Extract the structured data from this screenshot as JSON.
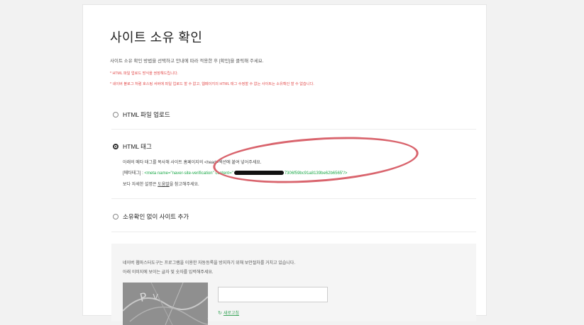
{
  "page": {
    "title": "사이트 소유 확인",
    "description": "사이트 소유 확인 방법을 선택하고 안내에 따라 적용한 후 [확인]을 클릭해 주세요.",
    "warnings": [
      "* HTML 파일 업로드 방식을 권장해드립니다.",
      "* 네이버 블로그 처럼 호스팅 서버에 파일 업로드 할 수 없고, 웹페이지의 HTML 태그 수정할 수 없는 사이트는 소유확인 할 수 없습니다."
    ]
  },
  "options": {
    "html_file": {
      "label": "HTML 파일 업로드",
      "selected": false
    },
    "html_tag": {
      "label": "HTML 태그",
      "selected": true,
      "line1": "아래의 메타 태그를 복사해 사이트 홈페이지의 <head>섹션에 붙여 넣어주세요.",
      "meta_prefix": "[메타태그] : ",
      "meta_code_start": "<meta name=\"naver-site-verification\" content=\"",
      "meta_code_end": "7306f59bc91a8139be62b6565\"/>",
      "help_prefix": "보다 자세한 설명은 ",
      "help_link": "도움말",
      "help_suffix": "을 참고해주세요."
    },
    "no_verify": {
      "label": "소유확인 없이 사이트 추가",
      "selected": false
    }
  },
  "captcha": {
    "line1": "네이버 웹마스터도구는 프로그램을 이용한 자동등록을 방지하기 위해 보안절차를 거치고 있습니다.",
    "line2": "아래 이미지에 보이는 글자 및 숫자를 입력해주세요.",
    "input_value": "",
    "refresh_label": "새로고침",
    "refresh_icon": "refresh-icon"
  },
  "colors": {
    "warning": "#e24b4b",
    "meta_code": "#1eaa4a",
    "highlight_ellipse": "#d9646d"
  }
}
